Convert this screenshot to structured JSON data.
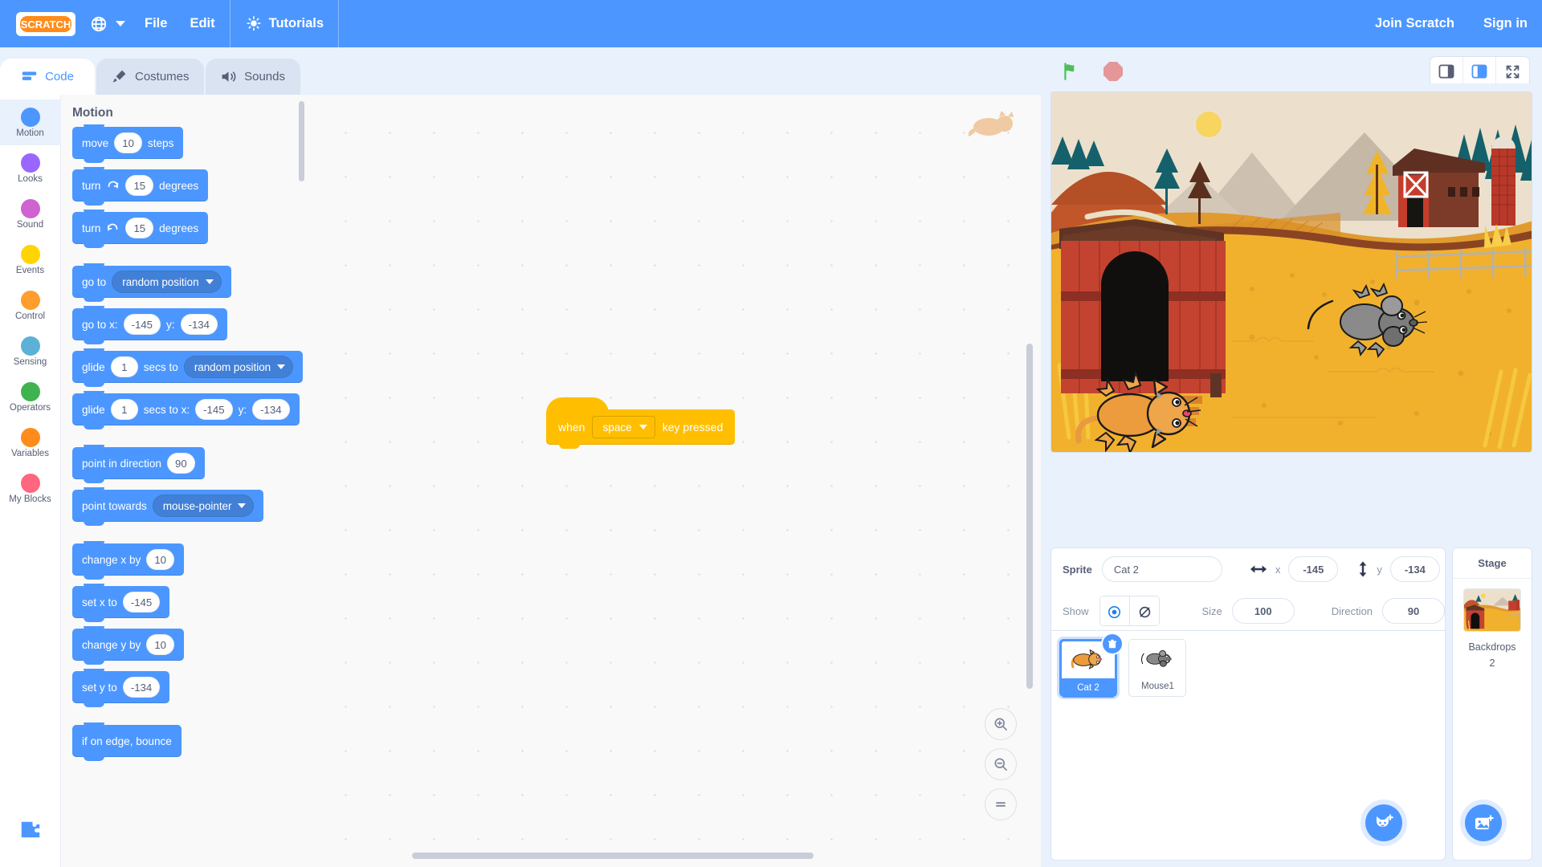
{
  "app": {
    "name": "Scratch",
    "logo_text": "SCRATCH"
  },
  "menubar": {
    "globe_icon": "globe-icon",
    "items": [
      {
        "label": "File",
        "name": "menu-file"
      },
      {
        "label": "Edit",
        "name": "menu-edit"
      }
    ],
    "tutorials": {
      "label": "Tutorials",
      "icon": "lightbulb-icon"
    },
    "right": [
      {
        "label": "Join Scratch",
        "name": "join-scratch-link"
      },
      {
        "label": "Sign in",
        "name": "sign-in-link"
      }
    ]
  },
  "tabs": [
    {
      "label": "Code",
      "icon": "code-icon",
      "active": true
    },
    {
      "label": "Costumes",
      "icon": "paintbrush-icon",
      "active": false
    },
    {
      "label": "Sounds",
      "icon": "speaker-icon",
      "active": false
    }
  ],
  "stage_controls": {
    "green_flag": "green-flag-icon",
    "stop": "stop-icon",
    "green_flag_color": "#4cbf56",
    "stop_color": "#e49699"
  },
  "layout_buttons": [
    {
      "name": "small-stage-button",
      "selected": false
    },
    {
      "name": "large-stage-button",
      "selected": true
    },
    {
      "name": "fullscreen-button",
      "selected": false
    }
  ],
  "categories": [
    {
      "label": "Motion",
      "color": "#4c97ff",
      "active": true
    },
    {
      "label": "Looks",
      "color": "#9966ff",
      "active": false
    },
    {
      "label": "Sound",
      "color": "#cf63cf",
      "active": false
    },
    {
      "label": "Events",
      "color": "#ffd500",
      "active": false
    },
    {
      "label": "Control",
      "color": "#ff9d2e",
      "active": false
    },
    {
      "label": "Sensing",
      "color": "#5cb1d6",
      "active": false
    },
    {
      "label": "Operators",
      "color": "#3fb34f",
      "active": false
    },
    {
      "label": "Variables",
      "color": "#ff8c1a",
      "active": false
    },
    {
      "label": "My Blocks",
      "color": "#ff6680",
      "active": false
    }
  ],
  "palette": {
    "title": "Motion",
    "blocks": [
      {
        "id": "move",
        "parts": [
          {
            "t": "text",
            "v": "move"
          },
          {
            "t": "num",
            "v": "10"
          },
          {
            "t": "text",
            "v": "steps"
          }
        ],
        "gap": false
      },
      {
        "id": "turn-right",
        "parts": [
          {
            "t": "text",
            "v": "turn"
          },
          {
            "t": "icon",
            "v": "turn-clockwise-icon"
          },
          {
            "t": "num",
            "v": "15"
          },
          {
            "t": "text",
            "v": "degrees"
          }
        ],
        "gap": false
      },
      {
        "id": "turn-left",
        "parts": [
          {
            "t": "text",
            "v": "turn"
          },
          {
            "t": "icon",
            "v": "turn-counterclockwise-icon"
          },
          {
            "t": "num",
            "v": "15"
          },
          {
            "t": "text",
            "v": "degrees"
          }
        ],
        "gap": true
      },
      {
        "id": "go-to",
        "parts": [
          {
            "t": "text",
            "v": "go to"
          },
          {
            "t": "drop",
            "v": "random position"
          }
        ],
        "gap": false
      },
      {
        "id": "go-to-xy",
        "parts": [
          {
            "t": "text",
            "v": "go to x:"
          },
          {
            "t": "num",
            "v": "-145"
          },
          {
            "t": "text",
            "v": "y:"
          },
          {
            "t": "num",
            "v": "-134"
          }
        ],
        "gap": false
      },
      {
        "id": "glide-to",
        "parts": [
          {
            "t": "text",
            "v": "glide"
          },
          {
            "t": "num",
            "v": "1"
          },
          {
            "t": "text",
            "v": "secs to"
          },
          {
            "t": "drop",
            "v": "random position"
          }
        ],
        "gap": false
      },
      {
        "id": "glide-to-xy",
        "parts": [
          {
            "t": "text",
            "v": "glide"
          },
          {
            "t": "num",
            "v": "1"
          },
          {
            "t": "text",
            "v": "secs to x:"
          },
          {
            "t": "num",
            "v": "-145"
          },
          {
            "t": "text",
            "v": "y:"
          },
          {
            "t": "num",
            "v": "-134"
          }
        ],
        "gap": true
      },
      {
        "id": "point-dir",
        "parts": [
          {
            "t": "text",
            "v": "point in direction"
          },
          {
            "t": "num",
            "v": "90"
          }
        ],
        "gap": false
      },
      {
        "id": "point-towards",
        "parts": [
          {
            "t": "text",
            "v": "point towards"
          },
          {
            "t": "drop",
            "v": "mouse-pointer"
          }
        ],
        "gap": true
      },
      {
        "id": "change-x",
        "parts": [
          {
            "t": "text",
            "v": "change x by"
          },
          {
            "t": "num",
            "v": "10"
          }
        ],
        "gap": false
      },
      {
        "id": "set-x",
        "parts": [
          {
            "t": "text",
            "v": "set x to"
          },
          {
            "t": "num",
            "v": "-145"
          }
        ],
        "gap": false
      },
      {
        "id": "change-y",
        "parts": [
          {
            "t": "text",
            "v": "change y by"
          },
          {
            "t": "num",
            "v": "10"
          }
        ],
        "gap": false
      },
      {
        "id": "set-y",
        "parts": [
          {
            "t": "text",
            "v": "set y to"
          },
          {
            "t": "num",
            "v": "-134"
          }
        ],
        "gap": true
      },
      {
        "id": "if-on-edge",
        "parts": [
          {
            "t": "text",
            "v": "if on edge, bounce"
          }
        ],
        "gap": true
      }
    ]
  },
  "workspace": {
    "script": {
      "when_label": "when",
      "key_value": "space",
      "pressed_label": "key pressed"
    },
    "zoom_buttons": [
      {
        "name": "zoom-in-button",
        "icon": "zoom-in-icon"
      },
      {
        "name": "zoom-out-button",
        "icon": "zoom-out-icon"
      },
      {
        "name": "zoom-reset-button",
        "icon": "zoom-reset-icon"
      }
    ]
  },
  "sprite_info": {
    "sprite_label": "Sprite",
    "sprite_name": "Cat 2",
    "x_label": "x",
    "x_value": "-145",
    "y_label": "y",
    "y_value": "-134",
    "show_label": "Show",
    "show_on": true,
    "size_label": "Size",
    "size_value": "100",
    "direction_label": "Direction",
    "direction_value": "90"
  },
  "sprites": [
    {
      "name": "Cat 2",
      "selected": true,
      "icon": "cat-thumbnail"
    },
    {
      "name": "Mouse1",
      "selected": false,
      "icon": "mouse-thumbnail"
    }
  ],
  "stage_panel": {
    "header": "Stage",
    "backdrops_label": "Backdrops",
    "backdrops_count": "2"
  },
  "fabs": [
    {
      "name": "add-sprite-button",
      "icon": "cat-plus-icon"
    },
    {
      "name": "add-backdrop-button",
      "icon": "image-plus-icon"
    }
  ],
  "colors": {
    "brand_blue": "#4c97ff",
    "motion_blue": "#4c97ff",
    "events_yellow": "#ffbf00",
    "panel_bg": "#e8f1fc",
    "text_gray": "#575e75"
  }
}
